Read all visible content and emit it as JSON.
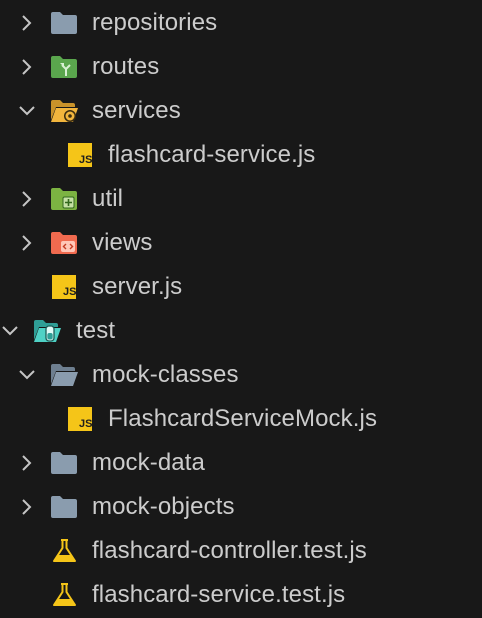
{
  "explorer": {
    "items": [
      {
        "label": "repositories",
        "type": "folder",
        "expanded": false,
        "icon": "folder-icon",
        "color": "#8a9cae"
      },
      {
        "label": "routes",
        "type": "folder",
        "expanded": false,
        "icon": "folder-routes-icon",
        "color": "#5aa64d"
      },
      {
        "label": "services",
        "type": "folder",
        "expanded": true,
        "icon": "folder-services-open-icon",
        "color": "#f2b53d"
      },
      {
        "label": "flashcard-service.js",
        "type": "file",
        "icon": "js-file-icon",
        "color": "#f5c518"
      },
      {
        "label": "util",
        "type": "folder",
        "expanded": false,
        "icon": "folder-util-icon",
        "color": "#7cb342"
      },
      {
        "label": "views",
        "type": "folder",
        "expanded": false,
        "icon": "folder-views-icon",
        "color": "#f06a4f"
      },
      {
        "label": "server.js",
        "type": "file",
        "icon": "js-file-icon",
        "color": "#f5c518"
      },
      {
        "label": "test",
        "type": "folder",
        "expanded": true,
        "icon": "folder-test-open-icon",
        "color": "#4fd1c5"
      },
      {
        "label": "mock-classes",
        "type": "folder",
        "expanded": true,
        "icon": "folder-open-icon",
        "color": "#8a9cae"
      },
      {
        "label": "FlashcardServiceMock.js",
        "type": "file",
        "icon": "js-file-icon",
        "color": "#f5c518"
      },
      {
        "label": "mock-data",
        "type": "folder",
        "expanded": false,
        "icon": "folder-icon",
        "color": "#8a9cae"
      },
      {
        "label": "mock-objects",
        "type": "folder",
        "expanded": false,
        "icon": "folder-icon",
        "color": "#8a9cae"
      },
      {
        "label": "flashcard-controller.test.js",
        "type": "file",
        "icon": "test-flask-icon",
        "color": "#f5c518"
      },
      {
        "label": "flashcard-service.test.js",
        "type": "file",
        "icon": "test-flask-icon",
        "color": "#f5c518"
      }
    ]
  }
}
